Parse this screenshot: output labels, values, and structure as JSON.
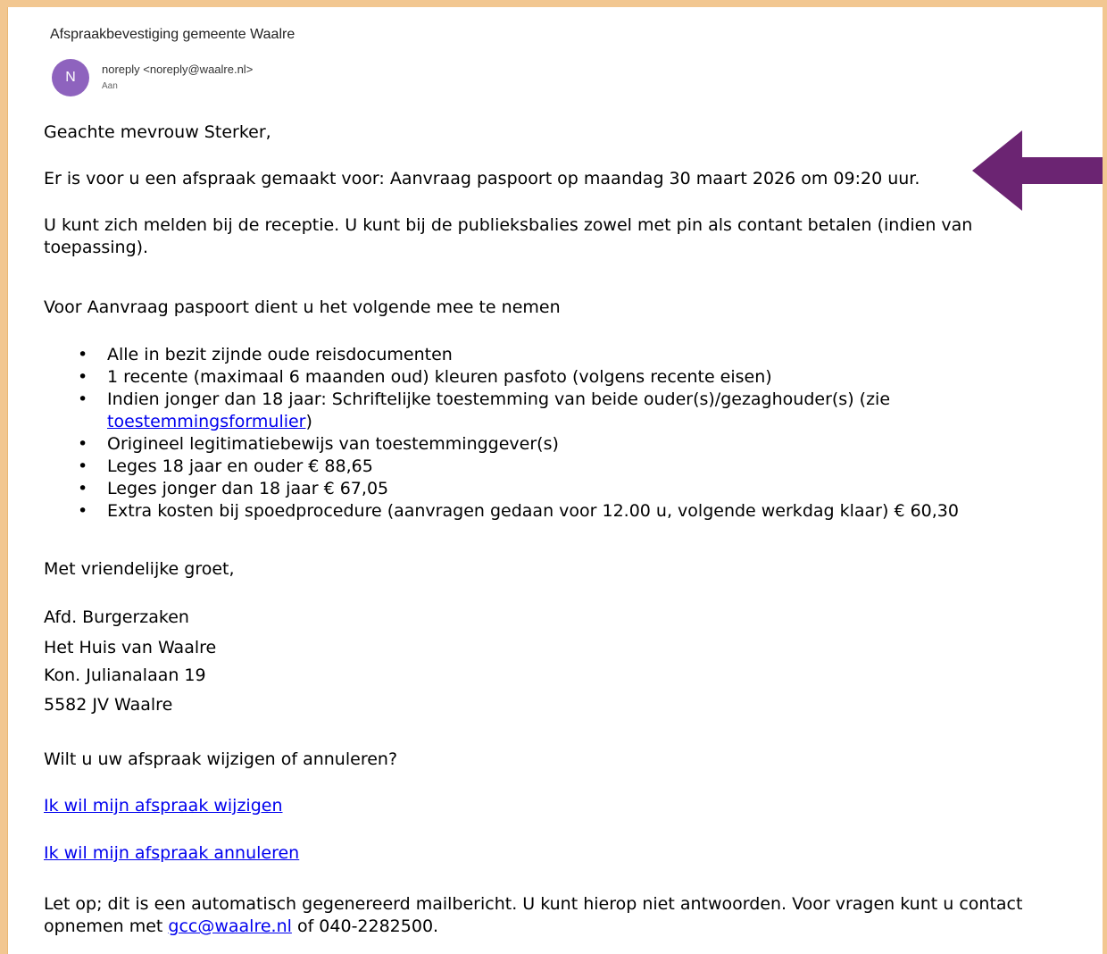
{
  "email": {
    "subject": "Afspraakbevestiging gemeente Waalre",
    "avatar_initial": "N",
    "sender": "noreply <noreply@waalre.nl>",
    "to_label": "Aan"
  },
  "body": {
    "greeting": "Geachte mevrouw Sterker,",
    "appointment": "Er is voor u een afspraak gemaakt voor: Aanvraag paspoort op maandag 30 maart 2026 om 09:20 uur.",
    "melden": "U kunt zich melden bij de receptie. U kunt bij de publieksbalies zowel met pin als contant betalen (indien van toepassing).",
    "voor": "Voor Aanvraag paspoort dient u het volgende mee te nemen",
    "list": {
      "item1": "Alle in bezit zijnde oude reisdocumenten",
      "item2": "1 recente (maximaal 6 maanden oud) kleuren pasfoto (volgens recente eisen)",
      "item3_prefix": "Indien jonger dan 18 jaar: Schriftelijke toestemming van beide ouder(s)/gezaghouder(s) (zie ",
      "item3_link": "toestemmingsformulier",
      "item3_suffix": ")",
      "item4": "Origineel legitimatiebewijs van toestemminggever(s)",
      "item5": "Leges 18 jaar en ouder € 88,65",
      "item6": "Leges jonger dan 18 jaar € 67,05",
      "item7": "Extra kosten bij spoedprocedure (aanvragen gedaan voor 12.00 u, volgende werkdag klaar) € 60,30"
    },
    "closing": "Met vriendelijke groet,",
    "signature": {
      "dept": "Afd. Burgerzaken",
      "building": "Het Huis van Waalre",
      "street": "Kon. Julianalaan 19",
      "postal": "5582 JV Waalre"
    },
    "change_question": "Wilt u uw afspraak wijzigen of annuleren?",
    "link_change": "Ik wil mijn afspraak wijzigen",
    "link_cancel": "Ik wil mijn afspraak annuleren",
    "notice_prefix": "Let op; dit is een automatisch gegenereerd mailbericht. U kunt hierop niet antwoorden. Voor vragen kunt u contact opnemen met ",
    "notice_email": "gcc@waalre.nl",
    "notice_suffix": " of 040-2282500."
  },
  "colors": {
    "frame": "#f2c791",
    "avatar": "#8e63be",
    "arrow": "#6b2472",
    "link": "#0000ee"
  },
  "icons": {
    "arrow": "left-arrow-icon"
  }
}
